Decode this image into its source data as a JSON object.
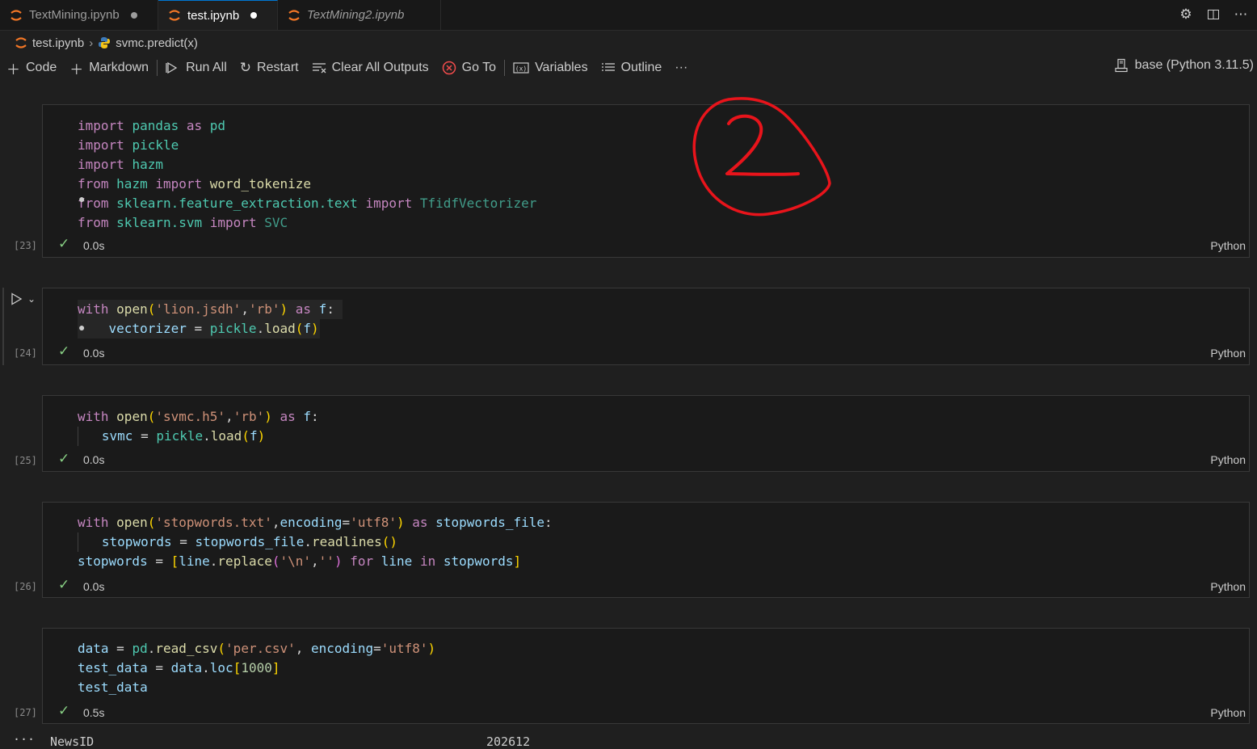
{
  "tabs": [
    {
      "label": "TextMining.ipynb",
      "active": false,
      "italic": false,
      "dirty": true
    },
    {
      "label": "test.ipynb",
      "active": true,
      "italic": false,
      "dirty": true
    },
    {
      "label": "TextMining2.ipynb",
      "active": false,
      "italic": true,
      "dirty": false
    }
  ],
  "breadcrumb": {
    "file": "test.ipynb",
    "symbol": "svmc.predict(x)"
  },
  "toolbar": {
    "code": "Code",
    "markdown": "Markdown",
    "run_all": "Run All",
    "restart": "Restart",
    "clear_outputs": "Clear All Outputs",
    "go_to": "Go To",
    "variables": "Variables",
    "outline": "Outline",
    "more": "···"
  },
  "kernel": "base (Python 3.11.5)",
  "cells": [
    {
      "count": "[23]",
      "duration": "0.0s",
      "language": "Python"
    },
    {
      "count": "[24]",
      "duration": "0.0s",
      "language": "Python"
    },
    {
      "count": "[25]",
      "duration": "0.0s",
      "language": "Python"
    },
    {
      "count": "[26]",
      "duration": "0.0s",
      "language": "Python"
    },
    {
      "count": "[27]",
      "duration": "0.5s",
      "language": "Python"
    }
  ],
  "code": {
    "c1": {
      "l1": [
        "import",
        "pandas",
        "as",
        "pd"
      ],
      "l2": [
        "import",
        "pickle"
      ],
      "l3": [
        "import",
        "hazm"
      ],
      "l4": [
        "from",
        "hazm",
        "import",
        "word_tokenize"
      ],
      "l5": [
        "from",
        "sklearn.feature_extraction.text",
        "import",
        "TfidfVectorizer"
      ],
      "l6": [
        "from",
        "sklearn.svm",
        "import",
        "SVC"
      ]
    },
    "c2": {
      "l1": [
        "with",
        "open",
        "(",
        "'lion.jsdh'",
        ",",
        "'rb'",
        ")",
        "as",
        "f",
        ":"
      ],
      "l2": [
        "vectorizer",
        " = ",
        "pickle",
        ".",
        "load",
        "(",
        "f",
        ")"
      ]
    },
    "c3": {
      "l1": [
        "with",
        "open",
        "(",
        "'svmc.h5'",
        ",",
        "'rb'",
        ")",
        "as",
        "f",
        ":"
      ],
      "l2": [
        "svmc",
        " = ",
        "pickle",
        ".",
        "load",
        "(",
        "f",
        ")"
      ]
    },
    "c4": {
      "l1": [
        "with",
        "open",
        "(",
        "'stopwords.txt'",
        ",",
        "encoding",
        "=",
        "'utf8'",
        ")",
        "as",
        "stopwords_file",
        ":"
      ],
      "l2": [
        "stopwords",
        " = ",
        "stopwords_file",
        ".",
        "readlines",
        "()"
      ],
      "l3": [
        "stopwords",
        " = ",
        "[",
        "line",
        ".",
        "replace",
        "(",
        "'\\n'",
        ",",
        "''",
        ")",
        "for",
        "line",
        "in",
        "stopwords",
        "]"
      ]
    },
    "c5": {
      "l1": [
        "data",
        " = ",
        "pd",
        ".",
        "read_csv",
        "(",
        "'per.csv'",
        ", ",
        "encoding",
        "=",
        "'utf8'",
        ")"
      ],
      "l2": [
        "test_data",
        " = ",
        "data",
        ".",
        "loc",
        "[",
        "1000",
        "]"
      ],
      "l3": [
        "test_data"
      ]
    }
  },
  "output": {
    "more": "···",
    "key": "NewsID",
    "value": "202612"
  },
  "annotation": {
    "text": "2",
    "color": "#e8141b"
  },
  "colors": {
    "accent": "#0078d4",
    "success": "#89d185",
    "background": "#1f1f1f"
  }
}
